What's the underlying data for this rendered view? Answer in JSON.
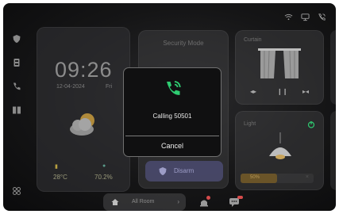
{
  "status_bar": {
    "icons": [
      "wifi-icon",
      "monitor-icon",
      "phone-call-icon"
    ]
  },
  "sidebar": {
    "icons": [
      "shield-icon",
      "device-icon",
      "phone-icon",
      "door-icon",
      "grid-icon"
    ]
  },
  "weather": {
    "time": "09:26",
    "date": "12-04-2024",
    "weekday": "Fri",
    "temperature": "28°C",
    "humidity": "70.2%"
  },
  "security": {
    "title": "Security Mode",
    "disarm_label": "Disarm"
  },
  "curtain": {
    "title": "Curtain",
    "controls": [
      "◂▸",
      "❙❙",
      "▸◂"
    ]
  },
  "light": {
    "title": "Light",
    "brightness_label": "50%",
    "brightness": 0.5,
    "close_glyph": "×"
  },
  "bottom_bar": {
    "room_label": "All Room",
    "arrow": "›"
  },
  "dialog": {
    "calling_text": "Calling 50501",
    "cancel_label": "Cancel"
  },
  "colors": {
    "accent_green": "#2ecc71",
    "disarm_purple": "#5c5c96",
    "badge_red": "#d64b4b"
  }
}
